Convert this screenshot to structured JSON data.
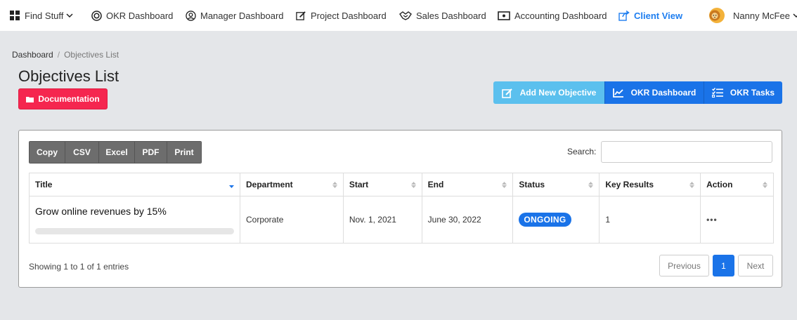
{
  "nav": {
    "find_stuff": "Find Stuff",
    "okr_dashboard": "OKR Dashboard",
    "manager_dashboard": "Manager Dashboard",
    "project_dashboard": "Project Dashboard",
    "sales_dashboard": "Sales Dashboard",
    "accounting_dashboard": "Accounting Dashboard",
    "client_view": "Client View",
    "user_name": "Nanny McFee"
  },
  "breadcrumb": {
    "root": "Dashboard",
    "separator": "/",
    "current": "Objectives List"
  },
  "page_title": "Objectives List",
  "documentation_label": "Documentation",
  "actions": {
    "add_objective": "Add New Objective",
    "okr_dashboard": "OKR Dashboard",
    "okr_tasks": "OKR Tasks"
  },
  "export": {
    "copy": "Copy",
    "csv": "CSV",
    "excel": "Excel",
    "pdf": "PDF",
    "print": "Print"
  },
  "search": {
    "label": "Search:",
    "value": ""
  },
  "table": {
    "headers": [
      "Title",
      "Department",
      "Start",
      "End",
      "Status",
      "Key Results",
      "Action"
    ],
    "rows": [
      {
        "title": "Grow online revenues by 15%",
        "progress": 0,
        "department": "Corporate",
        "start": "Nov. 1, 2021",
        "end": "June 30, 2022",
        "status": "ONGOING",
        "key_results": "1",
        "action": "•••"
      }
    ]
  },
  "info": "Showing 1 to 1 of 1 entries",
  "pagination": {
    "previous": "Previous",
    "current": "1",
    "next": "Next"
  },
  "colors": {
    "primary": "#1a73e8",
    "danger": "#f5264f",
    "info": "#5bc0ee",
    "secondary": "#6d6d6d"
  }
}
